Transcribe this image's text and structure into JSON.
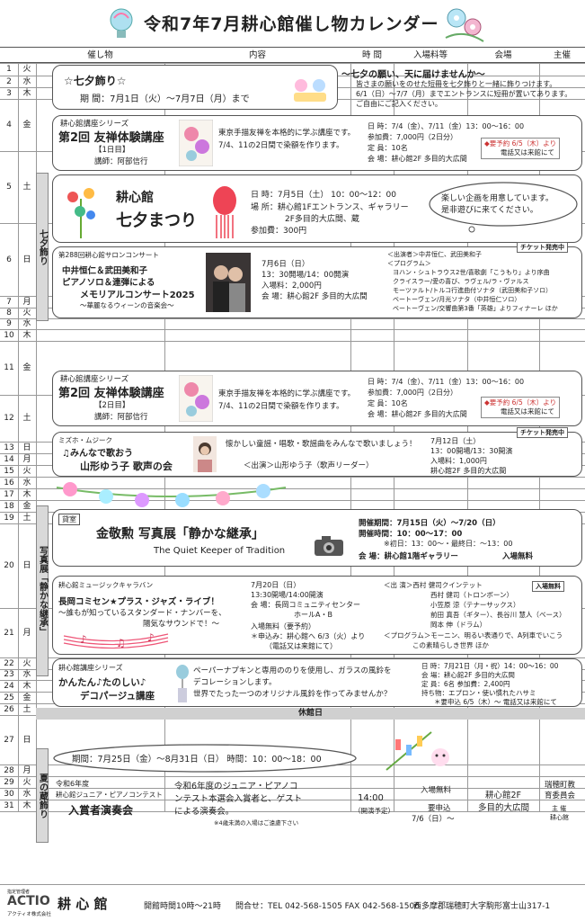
{
  "title": "令和7年7月耕心館催し物カレンダー",
  "columns": [
    "催し物",
    "内容",
    "時 間",
    "入場料等",
    "会場",
    "主催"
  ],
  "days": [
    {
      "d": "1",
      "w": "火"
    },
    {
      "d": "2",
      "w": "水"
    },
    {
      "d": "3",
      "w": "木"
    },
    {
      "d": "4",
      "w": "金"
    },
    {
      "d": "5",
      "w": "土"
    },
    {
      "d": "6",
      "w": "日"
    },
    {
      "d": "7",
      "w": "月"
    },
    {
      "d": "8",
      "w": "火"
    },
    {
      "d": "9",
      "w": "水"
    },
    {
      "d": "10",
      "w": "木"
    },
    {
      "d": "11",
      "w": "金"
    },
    {
      "d": "12",
      "w": "土"
    },
    {
      "d": "13",
      "w": "日"
    },
    {
      "d": "14",
      "w": "月"
    },
    {
      "d": "15",
      "w": "火"
    },
    {
      "d": "16",
      "w": "水"
    },
    {
      "d": "17",
      "w": "木"
    },
    {
      "d": "18",
      "w": "金"
    },
    {
      "d": "19",
      "w": "土"
    },
    {
      "d": "20",
      "w": "日"
    },
    {
      "d": "21",
      "w": "月"
    },
    {
      "d": "22",
      "w": "火"
    },
    {
      "d": "23",
      "w": "水"
    },
    {
      "d": "24",
      "w": "木"
    },
    {
      "d": "25",
      "w": "金"
    },
    {
      "d": "26",
      "w": "土"
    },
    {
      "d": "27",
      "w": "日"
    },
    {
      "d": "28",
      "w": "月"
    },
    {
      "d": "29",
      "w": "火"
    },
    {
      "d": "30",
      "w": "水"
    },
    {
      "d": "31",
      "w": "木"
    }
  ],
  "tanabata_col": "七夕飾り",
  "photo_col": "写真展「静かな継承」",
  "summer_col": "夏の蔵飾り",
  "ev1": {
    "title": "☆七夕飾り☆",
    "period": "期 間：7月1日（火）～7月7日（月）まで",
    "head": "～七夕の願い、天に届けませんか～",
    "l1": "皆さまの願いをのせた短冊を七夕飾りと一緒に飾りつけます。",
    "l2": "6/1（日）～7/7（月）までエントランスに短冊が置いてあります。",
    "l3": "ご自由にご記入ください。"
  },
  "ev2": {
    "series": "耕心館講座シリーズ",
    "title": "第2回 友禅体験講座",
    "sub": "【1日目】",
    "teacher": "講師：阿部信行",
    "d1": "東京手描友禅を本格的に学ぶ講座です。",
    "d2": "7/4、11の2日間で染額を作ります。",
    "i1": "日 時：7/4（金）、7/11（金）13：00～16：00",
    "i2": "参加費：7,000円（2日分）",
    "i3": "定 員：10名",
    "i4": "会 場：耕心館2F 多目的大広間",
    "resv1": "◆要予約 6/5（木）より",
    "resv2": "電話又は来館にて"
  },
  "ev3": {
    "t1": "耕心館",
    "t2": "七夕まつり",
    "i1": "日 時：7月5日（土） 10：00～12：00",
    "i2": "場 所：耕心館1Fエントランス、ギャラリー",
    "i3": "2F多目的大広間、蔵",
    "i4": "参加費：300円",
    "bubble1": "楽しい企画を用意しています。",
    "bubble2": "是非遊びに来てください。"
  },
  "ev4": {
    "series": "第288回耕心館サロンコンサート",
    "l1": "中井恒仁＆武田美和子",
    "l2": "ピアノソロ＆連弾による",
    "l3": "メモリアルコンサート2025",
    "l4": "～華麗なるウィーンの音楽会～",
    "i1": "7月6日（日）",
    "i2": "13：30開場/14：00開演",
    "i3": "入場料：2,000円",
    "i4": "会 場：耕心館2F 多目的大広間",
    "badge": "チケット発売中",
    "p0": "＜出演者＞中井恒仁、武田美和子",
    "p1": "＜プログラム＞",
    "p2": "ヨハン・シュトラウス2世/喜歌劇「こうもり」より序曲",
    "p3": "クライスラー/愛の喜び、ラヴェル/ラ・ヴァルス",
    "p4": "モーツァルト/トルコ行進曲付ソナタ（武田美和子ソロ）",
    "p5": "ベートーヴェン/月光ソナタ（中井恒仁ソロ）",
    "p6": "ベートーヴェン/交響曲第3番「英雄」よりフィナーレ ほか"
  },
  "ev5": {
    "series": "耕心館講座シリーズ",
    "title": "第2回 友禅体験講座",
    "sub": "【2日目】",
    "teacher": "講師：阿部信行",
    "d1": "東京手描友禅を本格的に学ぶ講座です。",
    "d2": "7/4、11の2日間で染額を作ります。",
    "i1": "日 時：7/4（金）、7/11（金）13：00～16：00",
    "i2": "参加費：7,000円（2日分）",
    "i3": "定 員：10名",
    "i4": "会 場：耕心館2F 多目的大広間",
    "resv1": "◆要予約 6/5（木）より",
    "resv2": "電話又は来館にて"
  },
  "ev6": {
    "series": "ミズホ・ムジーク",
    "l1": "♫みんなで歌おう",
    "l2": "山形ゆう子 歌声の会",
    "d1": "懐かしい童謡・唱歌・歌謡曲をみんなで歌いましょう！",
    "d2": "＜出演＞山形ゆう子（歌声リーダー）",
    "i1": "7月12日（土）",
    "i2": "13：00開場/13：30開演",
    "i3": "入場料：1,000円",
    "i4": "耕心館2F 多目的大広間",
    "badge": "チケット発売中"
  },
  "ev7": {
    "tag": "貸室",
    "title": "金敬勲 写真展「静かな継承」",
    "sub": "The Quiet Keeper of Tradition",
    "i1": "開催期間：7月15日（火）～7/20（日）",
    "i2": "開催時間：10：00～17：00",
    "i3": "※初日：13：00～・最終日：～13：00",
    "i4": "会 場：耕心館1階ギャラリー",
    "i5": "入場無料"
  },
  "ev8": {
    "series": "耕心館ミュージックキャラバン",
    "l1": "長岡コミセン★プラス・ジャズ・ライブ！",
    "l2": "～誰もが知っているスタンダード・ナンバーを、",
    "l3": "陽気なサウンドで！～",
    "i1": "7月20日（日）",
    "i2": "13:30開場/14:00開演",
    "i3": "会 場：長岡コミュニティセンター",
    "i4": "ホールA・B",
    "i5": "入場無料（要予約）",
    "i6": "＊申込み：耕心館へ 6/3（火）より",
    "i7": "（電話又は来館にて）",
    "badge": "入場無料",
    "p0": "＜出 演＞西村 健司クインテット",
    "p1": "西村 健司（トロンボーン）",
    "p2": "小笠原 涼（テナーサックス）",
    "p3": "前田 真吾（ギター）、長谷川 慧人（ベース）",
    "p4": "岡本 伸（ドラム）",
    "p5": "＜プログラム＞モーニン、明るい表通りで、A列車でいこう",
    "p6": "この素晴らしき世界 ほか"
  },
  "ev9": {
    "series": "耕心館講座シリーズ",
    "l1": "かんたん♪たのしい♪",
    "l2": "デコパージュ講座",
    "d1": "ペーパーナプキンと専用ののりを使用し、ガラスの風鈴を",
    "d2": "デコレーションします。",
    "d3": "世界でたった一つのオリジナル風鈴を作ってみませんか？",
    "i1": "日 時：7月21日（月・祝）14：00～16：00",
    "i2": "会 場：耕心館2F 多目的大広間",
    "i3": "定 員：6名 参加費：2,400円",
    "i4": "持ち物：エプロン・使い慣れたハサミ",
    "i5": "＊要申込 6/5（木）～ 電話又は来館にて"
  },
  "closed": "休館日",
  "ev10": {
    "period": "期間：7月25日（金）～8月31日（日） 時間：10：00～18：00"
  },
  "ev11": {
    "l1": "令和6年度",
    "l2": "耕心館ジュニア・ピアノコンテスト",
    "l3": "入賞者演奏会",
    "d1": "令和6年度のジュニア・ピアノコ",
    "d2": "ンテスト本選会入賞者と、ゲスト",
    "d3": "による演奏会。",
    "d4": "※4歳未満の入場はご遠慮下さい",
    "t1": "14:00",
    "t2": "（開演予定）",
    "f1": "入場無料",
    "f2": "要申込",
    "f3": "7/6（日）～",
    "v1": "耕心館2F",
    "v2": "多目的大広間",
    "h1": "瑞穂町教",
    "h2": "育委員会",
    "h3": "主 催",
    "h4": "耕心館"
  },
  "footer": {
    "sponsor": "指定管理者",
    "logo": "ACTIO",
    "logo_sub": "アクティオ株式会社",
    "brand": "耕 心 館",
    "hours": "開館時間10時～21時",
    "contact": "問合せ：TEL 042-568-1505 FAX 042-568-1506",
    "address": "西多摩郡瑞穂町大字駒形富士山317-1"
  }
}
